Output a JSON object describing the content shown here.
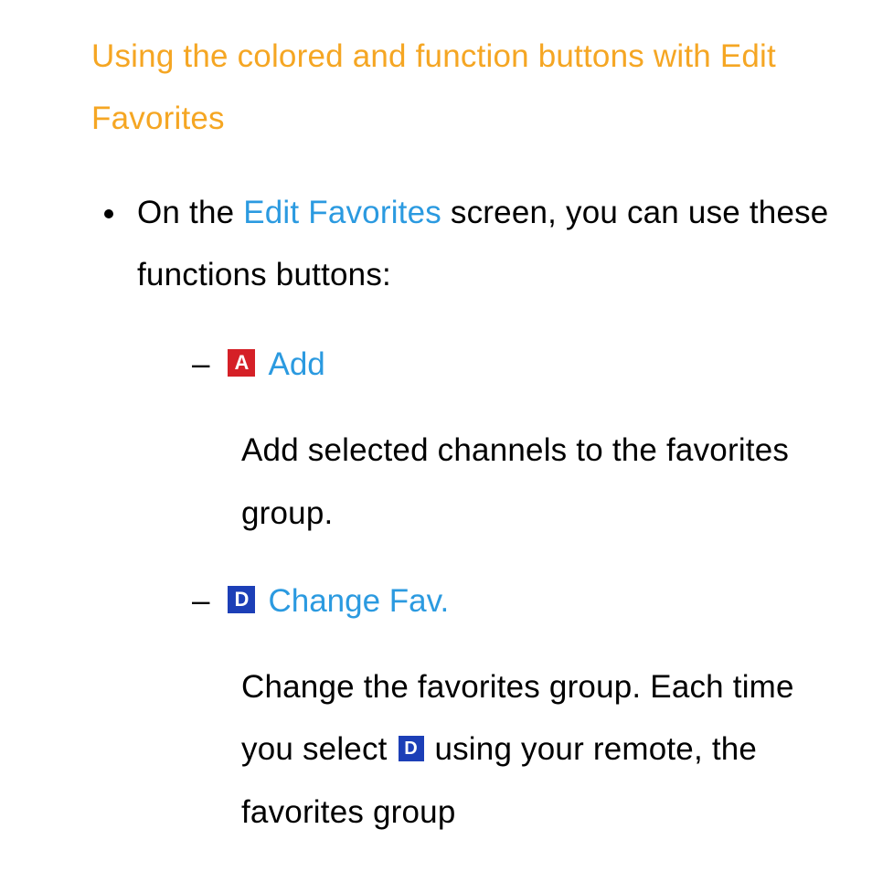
{
  "heading": "Using the colored and function buttons with Edit Favorites",
  "intro_before": "On the ",
  "intro_link": "Edit Favorites",
  "intro_after": " screen, you can use these functions buttons:",
  "items": [
    {
      "badge_letter": "A",
      "badge_color": "red",
      "label": "Add",
      "desc": "Add selected channels to the favorites group."
    },
    {
      "badge_letter": "D",
      "badge_color": "blue",
      "label": "Change Fav.",
      "desc_before": "Change the favorites group. Each time you select ",
      "desc_inline_badge": "D",
      "desc_after": " using your remote, the favorites group"
    }
  ]
}
